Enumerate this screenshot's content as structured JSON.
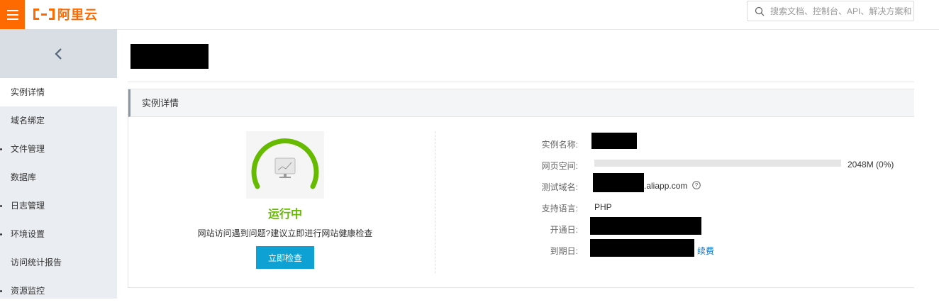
{
  "header": {
    "logo_text": "阿里云",
    "search_placeholder": "搜索文档、控制台、API、解决方案和资源"
  },
  "sidebar": {
    "items": [
      {
        "label": "实例详情",
        "active": true,
        "dot": false
      },
      {
        "label": "域名绑定",
        "active": false,
        "dot": false
      },
      {
        "label": "文件管理",
        "active": false,
        "dot": true
      },
      {
        "label": "数据库",
        "active": false,
        "dot": false
      },
      {
        "label": "日志管理",
        "active": false,
        "dot": true
      },
      {
        "label": "环境设置",
        "active": false,
        "dot": true
      },
      {
        "label": "访问统计报告",
        "active": false,
        "dot": false
      },
      {
        "label": "资源监控",
        "active": false,
        "dot": true
      }
    ]
  },
  "panel": {
    "title": "实例详情",
    "status": "运行中",
    "hint": "网站访问遇到问题?建议立即进行网站健康检查",
    "check_button": "立即检查",
    "info": {
      "name_label": "实例名称:",
      "space_label": "网页空间:",
      "space_value": "2048M (0%)",
      "space_fraction": 0,
      "domain_label": "测试域名:",
      "domain_suffix": ".aliapp.com",
      "lang_label": "支持语言:",
      "lang_value": "PHP",
      "open_label": "开通日:",
      "expire_label": "到期日:",
      "renew_label": "续费"
    }
  },
  "colors": {
    "accent": "#ff6a00",
    "button": "#0ea2d4",
    "status": "#66bb00",
    "link": "#0070cc"
  },
  "icons": [
    "menu-icon",
    "search-icon",
    "chevron-left-icon",
    "server-status-icon",
    "help-icon"
  ]
}
